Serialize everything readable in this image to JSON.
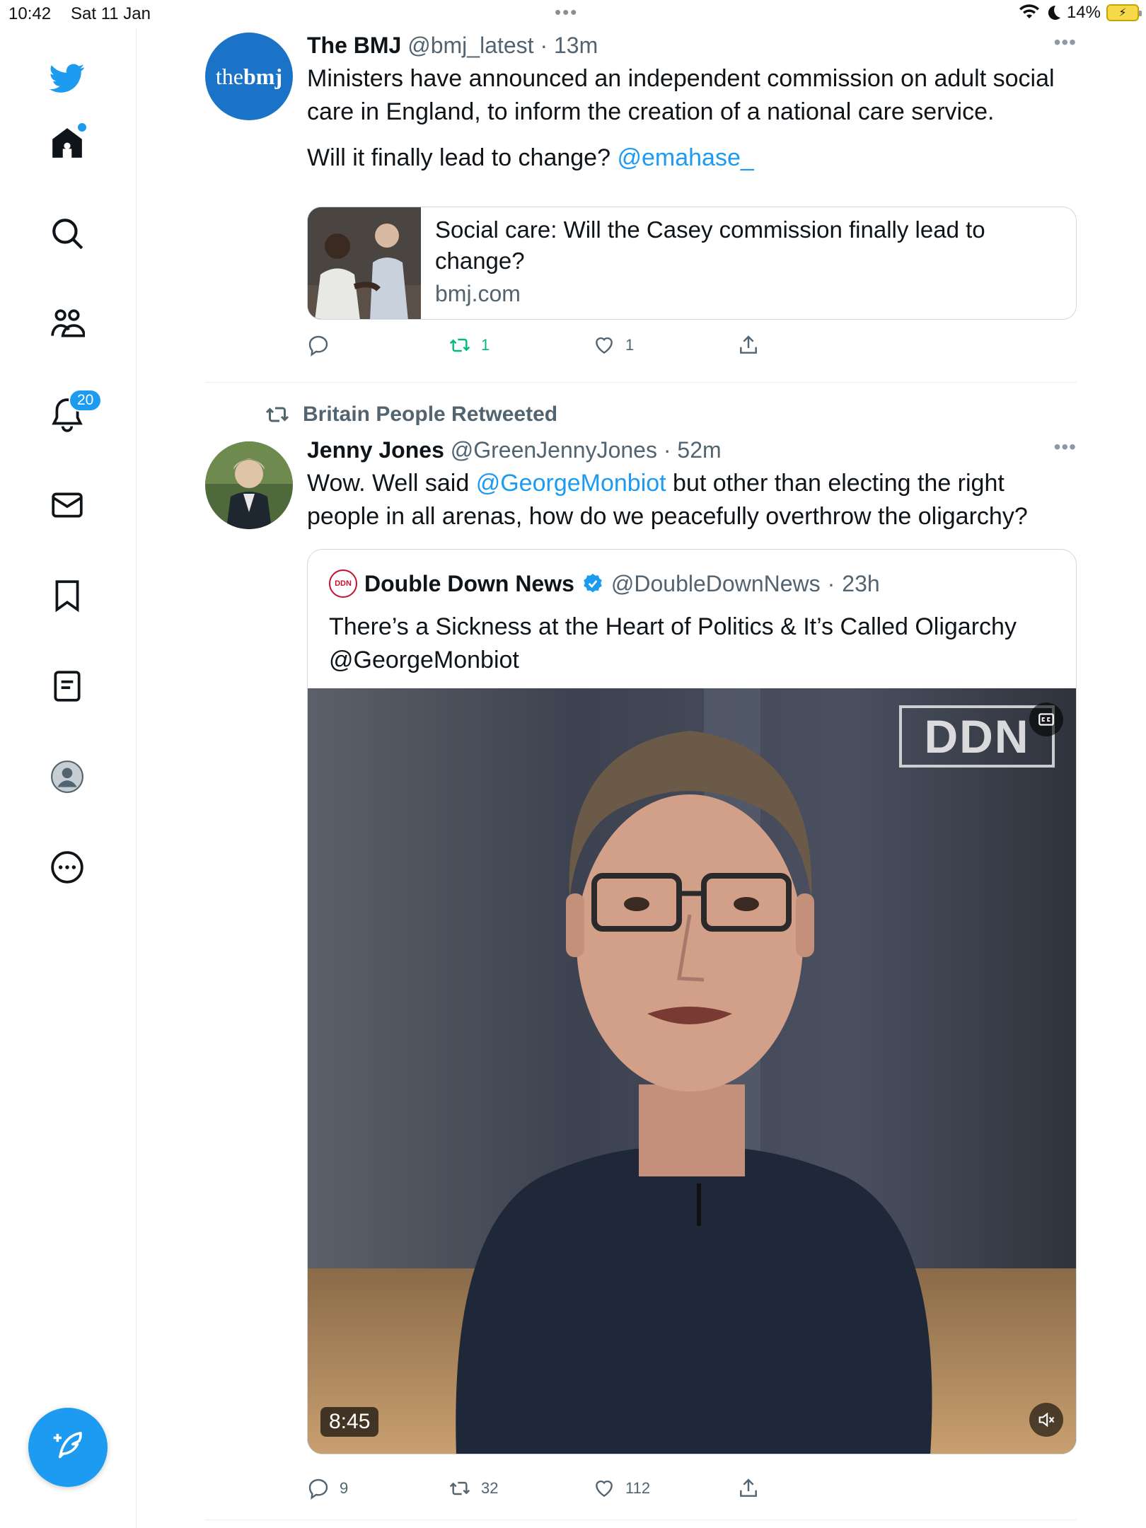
{
  "status_bar": {
    "time": "10:42",
    "date": "Sat 11 Jan",
    "battery": "14%"
  },
  "sidebar": {
    "notifications_badge": "20",
    "items": [
      {
        "icon": "twitter-bird-icon"
      },
      {
        "icon": "home-icon"
      },
      {
        "icon": "search-icon"
      },
      {
        "icon": "communities-icon"
      },
      {
        "icon": "notifications-bell-icon"
      },
      {
        "icon": "messages-envelope-icon"
      },
      {
        "icon": "bookmark-icon"
      },
      {
        "icon": "lists-icon"
      },
      {
        "icon": "profile-icon"
      },
      {
        "icon": "more-circle-icon"
      }
    ],
    "accent": "#1d9bf0"
  },
  "tweets": [
    {
      "author": "The BMJ",
      "handle": "@bmj_latest",
      "time": "13m",
      "avatar_text_1": "the",
      "avatar_text_2": "bmj",
      "text_1": "Ministers have announced an independent commission on adult social care in England, to inform the creation of a national care service.",
      "text_2": "Will it finally lead to change?",
      "mention": "@emahase_",
      "card": {
        "title": "Social care: Will the Casey commission finally lead to change?",
        "domain": "bmj.com"
      },
      "replies": "",
      "retweets": "1",
      "likes": "1"
    },
    {
      "retweeted_by": "Britain People Retweeted",
      "author": "Jenny Jones",
      "handle": "@GreenJennyJones",
      "time": "52m",
      "text_pre": "Wow. Well said ",
      "mention": "@GeorgeMonbiot",
      "text_post": " but other than electing the right people in all arenas, how do we peacefully overthrow the oligarchy?",
      "quote": {
        "logo_text": "DDN",
        "author": "Double Down News",
        "handle": "@DoubleDownNews",
        "time": "23h",
        "text": "There’s a Sickness at the Heart of Politics & It’s Called Oligarchy @GeorgeMonbiot",
        "video_watermark": "DDN",
        "video_duration": "8:45"
      },
      "replies": "9",
      "retweets": "32",
      "likes": "112"
    }
  ]
}
